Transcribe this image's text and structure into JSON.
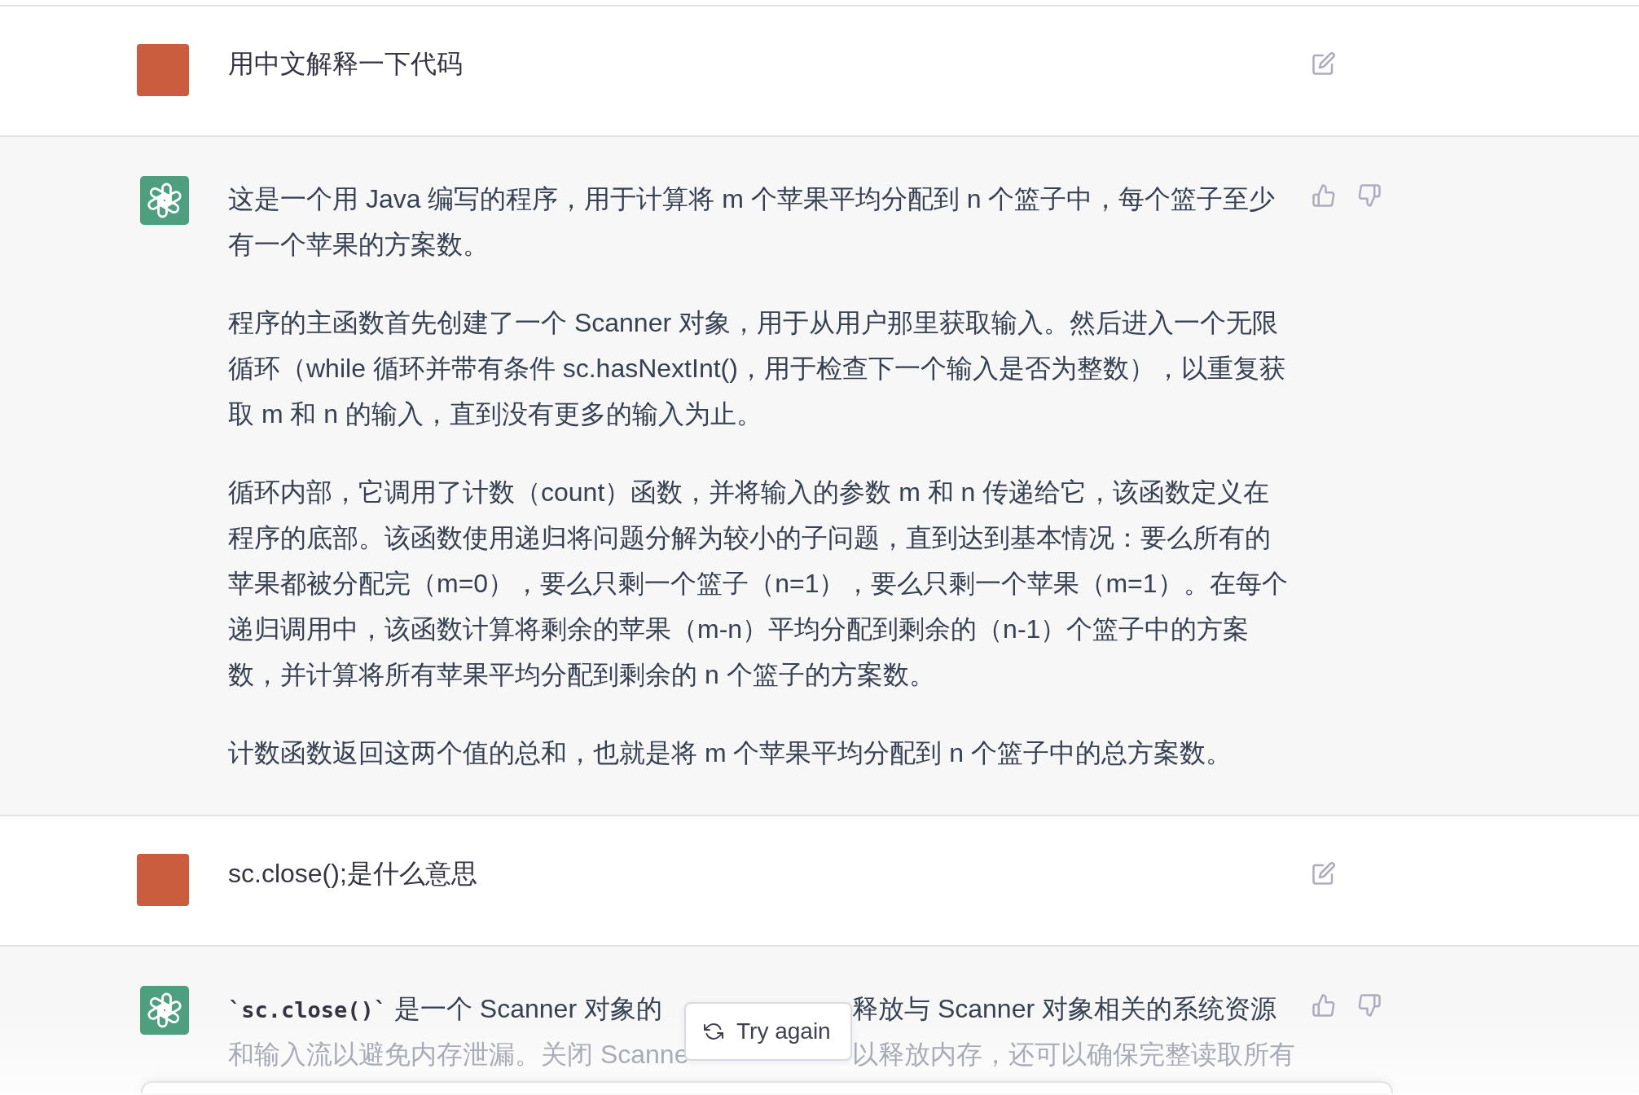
{
  "messages": [
    {
      "kind": "user",
      "text": "用中文解释一下代码"
    },
    {
      "kind": "assistant",
      "paragraphs": [
        "这是一个用 Java 编写的程序，用于计算将 m 个苹果平均分配到 n 个篮子中，每个篮子至少有一个苹果的方案数。",
        "程序的主函数首先创建了一个 Scanner 对象，用于从用户那里获取输入。然后进入一个无限循环（while 循环并带有条件 sc.hasNextInt()，用于检查下一个输入是否为整数），以重复获取 m 和 n 的输入，直到没有更多的输入为止。",
        "循环内部，它调用了计数（count）函数，并将输入的参数 m 和 n 传递给它，该函数定义在程序的底部。该函数使用递归将问题分解为较小的子问题，直到达到基本情况：要么所有的苹果都被分配完（m=0），要么只剩一个篮子（n=1），要么只剩一个苹果（m=1）。在每个递归调用中，该函数计算将剩余的苹果（m-n）平均分配到剩余的（n-1）个篮子中的方案数，并计算将所有苹果平均分配到剩余的 n 个篮子的方案数。",
        "计数函数返回这两个值的总和，也就是将 m 个苹果平均分配到 n 个篮子中的总方案数。"
      ]
    },
    {
      "kind": "user",
      "text": "sc.close();是什么意思"
    },
    {
      "kind": "assistant",
      "covered_lines": [
        {
          "left": [
            {
              "kind": "code",
              "text": "`sc.close()`"
            },
            {
              "kind": "plain",
              "text": " 是一个 Scanner 对象的"
            }
          ],
          "right": "释放与 Scanner 对象相关的系统资源"
        },
        {
          "left": [
            {
              "kind": "plain",
              "text": "和输入流以避免内存泄漏。关闭 Scanne"
            }
          ],
          "right": "以释放内存，还可以确保完整读取所有"
        }
      ]
    }
  ],
  "retry_button": {
    "label": "Try again"
  }
}
